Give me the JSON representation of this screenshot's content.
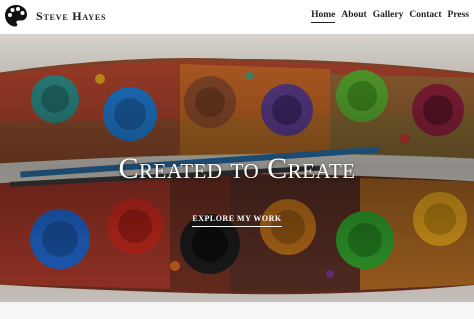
{
  "brand": {
    "name": "Steve Hayes",
    "icon": "palette-icon"
  },
  "nav": {
    "items": [
      {
        "label": "Home",
        "active": true
      },
      {
        "label": "About",
        "active": false
      },
      {
        "label": "Gallery",
        "active": false
      },
      {
        "label": "Contact",
        "active": false
      },
      {
        "label": "Press",
        "active": false
      }
    ]
  },
  "hero": {
    "title": "Created to Create",
    "cta_label": "EXPLORE MY WORK",
    "image": "watercolor-paint-palette-photo"
  },
  "colors": {
    "accent_text": "#ffffff",
    "nav_text": "#222222",
    "brand_text": "#1a1a1a"
  }
}
